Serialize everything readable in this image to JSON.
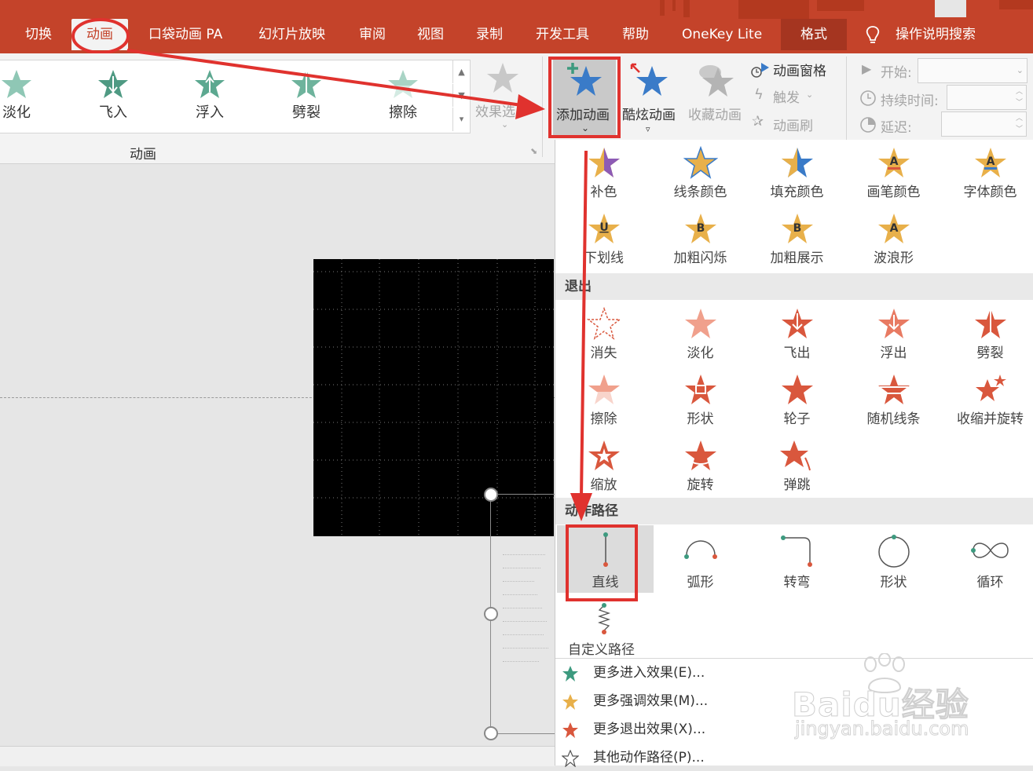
{
  "tabs": {
    "switch": "切换",
    "animation": "动画",
    "pocket": "口袋动画 PA",
    "slideshow": "幻灯片放映",
    "review": "审阅",
    "view": "视图",
    "record": "录制",
    "developer": "开发工具",
    "help": "帮助",
    "onekey": "OneKey Lite",
    "format": "格式",
    "tellme": "操作说明搜索"
  },
  "gallery": {
    "items": [
      "淡化",
      "飞入",
      "浮入",
      "劈裂",
      "擦除"
    ],
    "effect_options": "效果选",
    "group_label": "动画"
  },
  "ribbon": {
    "add_animation": "添加动画",
    "cool_animation": "酷炫动画",
    "collect_animation": "收藏动画",
    "animation_pane": "动画窗格",
    "trigger": "触发",
    "anim_painter": "动画刷",
    "start": "开始:",
    "duration": "持续时间:",
    "delay": "延迟:"
  },
  "emphasis": {
    "items": [
      "补色",
      "线条颜色",
      "填充颜色",
      "画笔颜色",
      "字体颜色",
      "下划线",
      "加粗闪烁",
      "加粗展示",
      "波浪形"
    ]
  },
  "exit": {
    "header": "退出",
    "items": [
      "消失",
      "淡化",
      "飞出",
      "浮出",
      "劈裂",
      "擦除",
      "形状",
      "轮子",
      "随机线条",
      "收缩并旋转",
      "缩放",
      "旋转",
      "弹跳"
    ]
  },
  "motion": {
    "header": "动作路径",
    "items": [
      "直线",
      "弧形",
      "转弯",
      "形状",
      "循环"
    ],
    "custom": "自定义路径"
  },
  "more": {
    "entrance": "更多进入效果(E)...",
    "emphasis": "更多强调效果(M)...",
    "exit": "更多退出效果(X)...",
    "motion": "其他动作路径(P)..."
  },
  "watermark": {
    "brand": "Baidu经验",
    "url": "jingyan.baidu.com"
  },
  "colors": {
    "accent": "#c4432a",
    "entrance_green": "#3d9a7f",
    "emphasis_gold": "#e8b04a",
    "exit_red": "#d9573d",
    "annotation_red": "#e0322e"
  }
}
